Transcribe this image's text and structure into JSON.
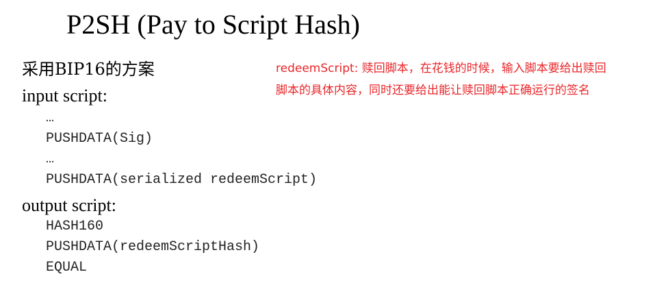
{
  "slide": {
    "title": "P2SH (Pay to Script Hash)",
    "scheme_line": "采用BIP16的方案",
    "input": {
      "label": "input script:",
      "lines": [
        "…",
        "PUSHDATA(Sig)",
        "…",
        "PUSHDATA(serialized redeemScript)"
      ]
    },
    "output": {
      "label": "output script:",
      "lines": [
        "HASH160",
        "PUSHDATA(redeemScriptHash)",
        "EQUAL"
      ]
    },
    "note": {
      "lines": [
        "redeemScript: 赎回脚本，在花钱的时候，输入脚本要给出赎回",
        "脚本的具体内容，同时还要给出能让赎回脚本正确运行的签名"
      ],
      "color": "#e8262a"
    }
  }
}
